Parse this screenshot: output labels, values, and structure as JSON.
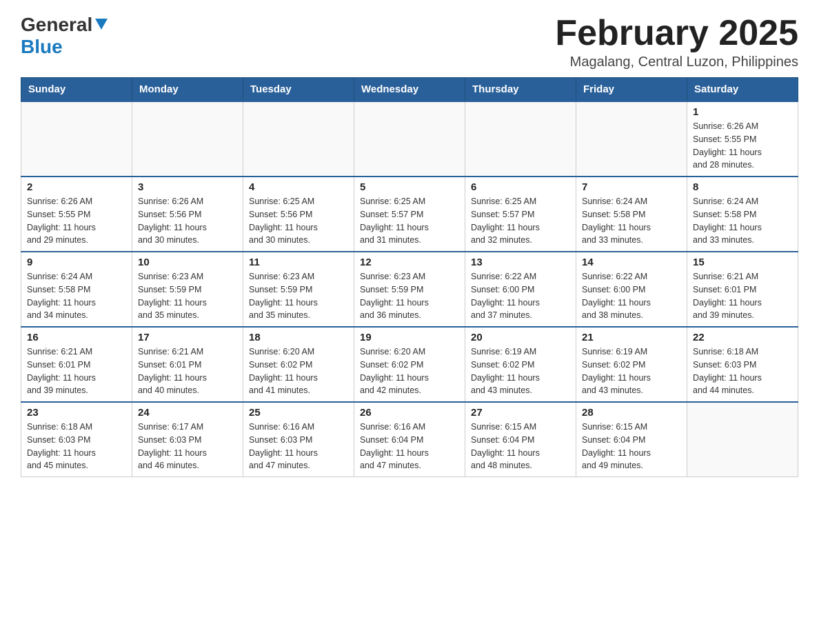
{
  "header": {
    "logo": {
      "general": "General",
      "blue": "Blue"
    },
    "title": "February 2025",
    "location": "Magalang, Central Luzon, Philippines"
  },
  "days_of_week": [
    "Sunday",
    "Monday",
    "Tuesday",
    "Wednesday",
    "Thursday",
    "Friday",
    "Saturday"
  ],
  "weeks": [
    {
      "days": [
        {
          "number": "",
          "info": ""
        },
        {
          "number": "",
          "info": ""
        },
        {
          "number": "",
          "info": ""
        },
        {
          "number": "",
          "info": ""
        },
        {
          "number": "",
          "info": ""
        },
        {
          "number": "",
          "info": ""
        },
        {
          "number": "1",
          "info": "Sunrise: 6:26 AM\nSunset: 5:55 PM\nDaylight: 11 hours\nand 28 minutes."
        }
      ]
    },
    {
      "days": [
        {
          "number": "2",
          "info": "Sunrise: 6:26 AM\nSunset: 5:55 PM\nDaylight: 11 hours\nand 29 minutes."
        },
        {
          "number": "3",
          "info": "Sunrise: 6:26 AM\nSunset: 5:56 PM\nDaylight: 11 hours\nand 30 minutes."
        },
        {
          "number": "4",
          "info": "Sunrise: 6:25 AM\nSunset: 5:56 PM\nDaylight: 11 hours\nand 30 minutes."
        },
        {
          "number": "5",
          "info": "Sunrise: 6:25 AM\nSunset: 5:57 PM\nDaylight: 11 hours\nand 31 minutes."
        },
        {
          "number": "6",
          "info": "Sunrise: 6:25 AM\nSunset: 5:57 PM\nDaylight: 11 hours\nand 32 minutes."
        },
        {
          "number": "7",
          "info": "Sunrise: 6:24 AM\nSunset: 5:58 PM\nDaylight: 11 hours\nand 33 minutes."
        },
        {
          "number": "8",
          "info": "Sunrise: 6:24 AM\nSunset: 5:58 PM\nDaylight: 11 hours\nand 33 minutes."
        }
      ]
    },
    {
      "days": [
        {
          "number": "9",
          "info": "Sunrise: 6:24 AM\nSunset: 5:58 PM\nDaylight: 11 hours\nand 34 minutes."
        },
        {
          "number": "10",
          "info": "Sunrise: 6:23 AM\nSunset: 5:59 PM\nDaylight: 11 hours\nand 35 minutes."
        },
        {
          "number": "11",
          "info": "Sunrise: 6:23 AM\nSunset: 5:59 PM\nDaylight: 11 hours\nand 35 minutes."
        },
        {
          "number": "12",
          "info": "Sunrise: 6:23 AM\nSunset: 5:59 PM\nDaylight: 11 hours\nand 36 minutes."
        },
        {
          "number": "13",
          "info": "Sunrise: 6:22 AM\nSunset: 6:00 PM\nDaylight: 11 hours\nand 37 minutes."
        },
        {
          "number": "14",
          "info": "Sunrise: 6:22 AM\nSunset: 6:00 PM\nDaylight: 11 hours\nand 38 minutes."
        },
        {
          "number": "15",
          "info": "Sunrise: 6:21 AM\nSunset: 6:01 PM\nDaylight: 11 hours\nand 39 minutes."
        }
      ]
    },
    {
      "days": [
        {
          "number": "16",
          "info": "Sunrise: 6:21 AM\nSunset: 6:01 PM\nDaylight: 11 hours\nand 39 minutes."
        },
        {
          "number": "17",
          "info": "Sunrise: 6:21 AM\nSunset: 6:01 PM\nDaylight: 11 hours\nand 40 minutes."
        },
        {
          "number": "18",
          "info": "Sunrise: 6:20 AM\nSunset: 6:02 PM\nDaylight: 11 hours\nand 41 minutes."
        },
        {
          "number": "19",
          "info": "Sunrise: 6:20 AM\nSunset: 6:02 PM\nDaylight: 11 hours\nand 42 minutes."
        },
        {
          "number": "20",
          "info": "Sunrise: 6:19 AM\nSunset: 6:02 PM\nDaylight: 11 hours\nand 43 minutes."
        },
        {
          "number": "21",
          "info": "Sunrise: 6:19 AM\nSunset: 6:02 PM\nDaylight: 11 hours\nand 43 minutes."
        },
        {
          "number": "22",
          "info": "Sunrise: 6:18 AM\nSunset: 6:03 PM\nDaylight: 11 hours\nand 44 minutes."
        }
      ]
    },
    {
      "days": [
        {
          "number": "23",
          "info": "Sunrise: 6:18 AM\nSunset: 6:03 PM\nDaylight: 11 hours\nand 45 minutes."
        },
        {
          "number": "24",
          "info": "Sunrise: 6:17 AM\nSunset: 6:03 PM\nDaylight: 11 hours\nand 46 minutes."
        },
        {
          "number": "25",
          "info": "Sunrise: 6:16 AM\nSunset: 6:03 PM\nDaylight: 11 hours\nand 47 minutes."
        },
        {
          "number": "26",
          "info": "Sunrise: 6:16 AM\nSunset: 6:04 PM\nDaylight: 11 hours\nand 47 minutes."
        },
        {
          "number": "27",
          "info": "Sunrise: 6:15 AM\nSunset: 6:04 PM\nDaylight: 11 hours\nand 48 minutes."
        },
        {
          "number": "28",
          "info": "Sunrise: 6:15 AM\nSunset: 6:04 PM\nDaylight: 11 hours\nand 49 minutes."
        },
        {
          "number": "",
          "info": ""
        }
      ]
    }
  ]
}
